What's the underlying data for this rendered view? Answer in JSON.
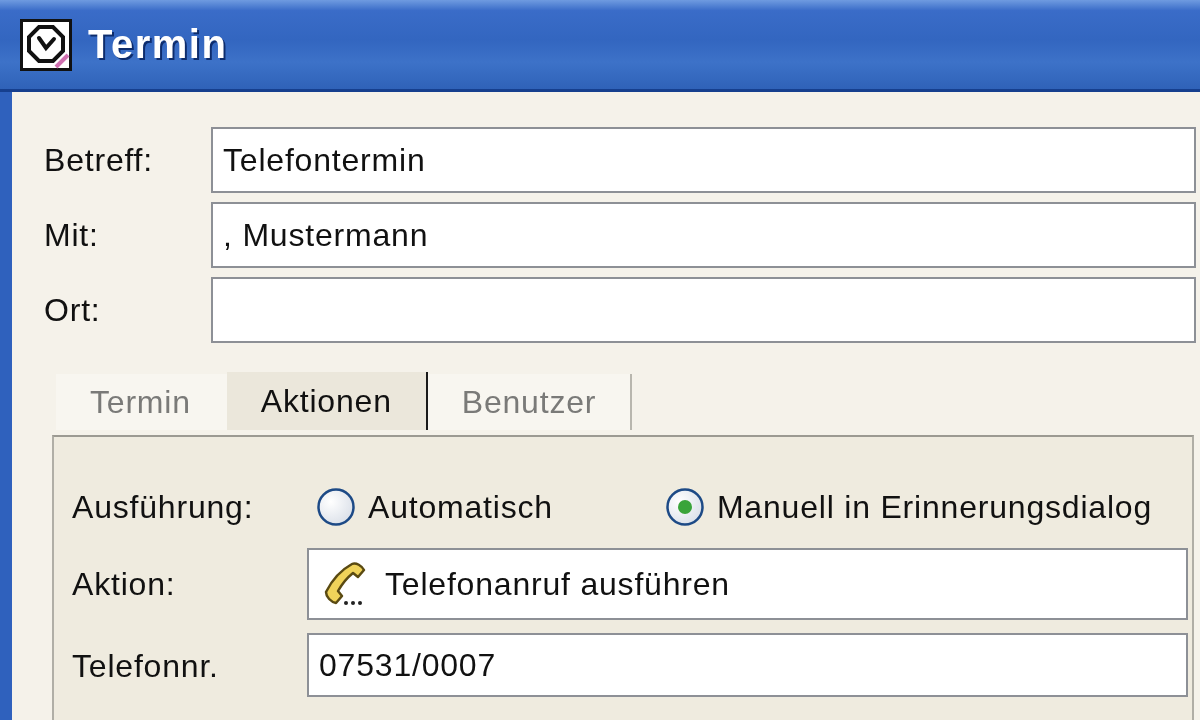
{
  "window": {
    "title": "Termin"
  },
  "fields": [
    {
      "label": "Betreff:",
      "value": "Telefontermin"
    },
    {
      "label": "Mit:",
      "value": ", Mustermann"
    },
    {
      "label": "Ort:"
    }
  ],
  "tabs": [
    {
      "label": "Termin",
      "selected": false
    },
    {
      "label": "Aktionen",
      "selected": true
    },
    {
      "label": "Benutzer",
      "selected": false
    }
  ],
  "panel": {
    "execution": {
      "label": "Ausführung:",
      "options": [
        {
          "label": "Automatisch",
          "selected": false
        },
        {
          "label": "Manuell in Erinnerungsdialog",
          "selected": true
        }
      ]
    },
    "action": {
      "label": "Aktion:",
      "value": "Telefonanruf ausführen"
    },
    "phone": {
      "label": "Telefonnr.",
      "value": "07531/0007"
    }
  }
}
